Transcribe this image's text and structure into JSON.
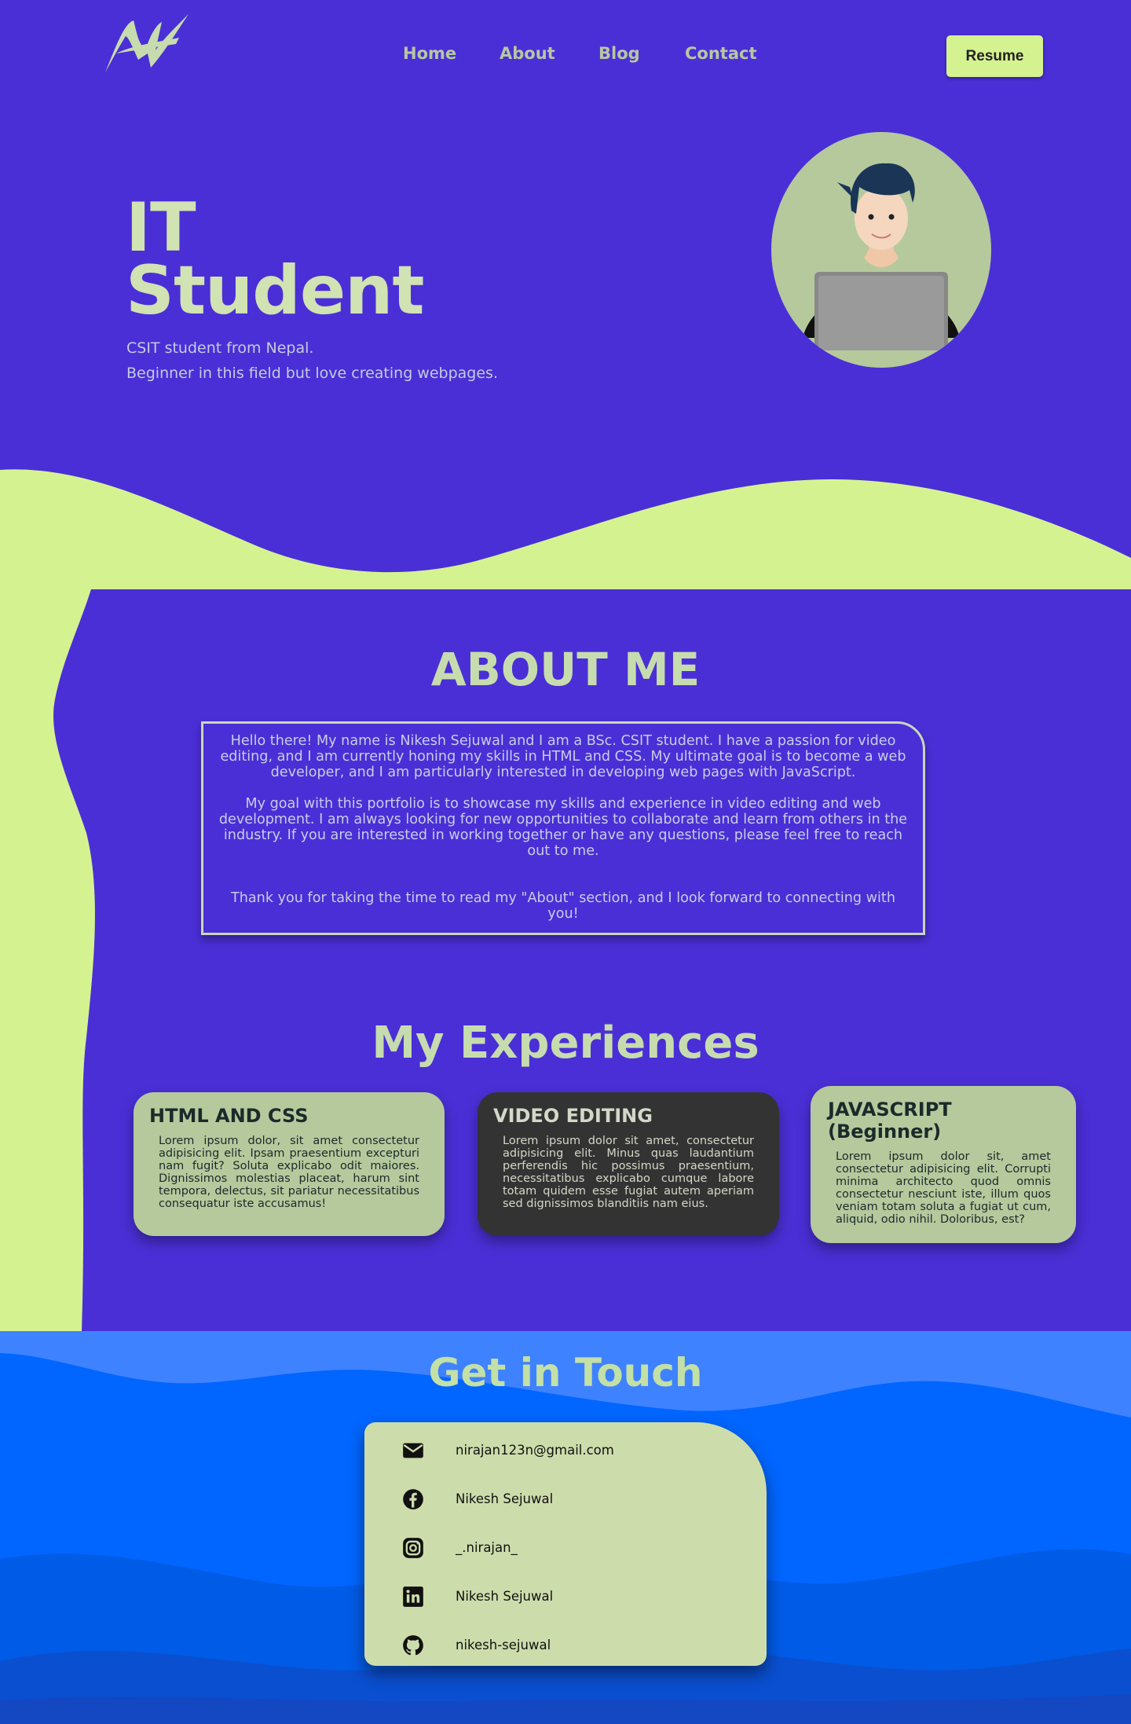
{
  "nav": {
    "links": [
      "Home",
      "About",
      "Blog",
      "Contact"
    ],
    "resume_label": "Resume"
  },
  "hero": {
    "title_line1": "IT",
    "title_line2": "Student",
    "subtitle1": "CSIT student from Nepal.",
    "subtitle2": "Beginner in this field but love creating webpages."
  },
  "about": {
    "title": "ABOUT ME",
    "p1": "Hello there! My name is Nikesh Sejuwal and I am a BSc. CSIT student. I have a passion for video editing, and I am currently honing my skills in HTML and CSS. My ultimate goal is to become a web developer, and I am particularly interested in developing web pages with JavaScript.",
    "p2": "My goal with this portfolio is to showcase my skills and experience in video editing and web development. I am always looking for new opportunities to collaborate and learn from others in the industry. If you are interested in working together or have any questions, please feel free to reach out to me.",
    "p3": "Thank you for taking the time to read my \"About\" section, and I look forward to connecting with you!"
  },
  "experiences": {
    "title": "My Experiences",
    "cards": [
      {
        "title": "HTML AND CSS",
        "text": "Lorem ipsum dolor, sit amet consectetur adipisicing elit. Ipsam praesentium excepturi nam fugit? Soluta explicabo odit maiores. Dignissimos molestias placeat, harum sint tempora, delectus, sit pariatur necessitatibus consequatur iste accusamus!"
      },
      {
        "title": "VIDEO EDITING",
        "text": "Lorem ipsum dolor sit amet, consectetur adipisicing elit. Minus quas laudantium perferendis hic possimus praesentium, necessitatibus explicabo cumque labore totam quidem esse fugiat autem aperiam sed dignissimos blanditiis nam eius."
      },
      {
        "title": "JAVASCRIPT (Beginner)",
        "text": "Lorem ipsum dolor sit, amet consectetur adipisicing elit. Corrupti minima architecto quod omnis consectetur nesciunt iste, illum quos veniam totam soluta a fugiat ut cum, aliquid, odio nihil. Doloribus, est?"
      }
    ]
  },
  "contact": {
    "title": "Get in Touch",
    "items": [
      {
        "icon": "email-icon",
        "text": "nirajan123n@gmail.com"
      },
      {
        "icon": "facebook-icon",
        "text": "Nikesh Sejuwal"
      },
      {
        "icon": "instagram-icon",
        "text": "_.nirajan_"
      },
      {
        "icon": "linkedin-icon",
        "text": "Nikesh Sejuwal"
      },
      {
        "icon": "github-icon",
        "text": "nikesh-sejuwal"
      }
    ]
  },
  "colors": {
    "background": "#4a2fd6",
    "accent_green": "#d5f291",
    "title_green": "#c7dcae",
    "card_green": "#b5c99d",
    "card_dark": "#333333",
    "contact_blue": "#0066ff"
  }
}
